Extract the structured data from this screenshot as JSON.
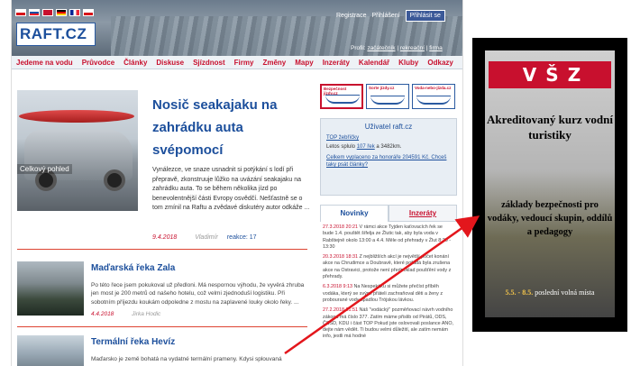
{
  "header": {
    "logo": "RAFT.CZ",
    "flags": [
      "#1c4f9c",
      "#ffffff",
      "#c8102e",
      "#000000",
      "#ce1126",
      "#ffcc00"
    ],
    "links": [
      "Registrace",
      "Přihlášení"
    ],
    "facebook": "Přihlásit se",
    "profil_label": "Profil:",
    "profil_links": [
      "začátečník",
      "rekreační",
      "firma"
    ]
  },
  "nav": [
    "Jedeme na vodu",
    "Průvodce",
    "Články",
    "Diskuse",
    "Sjízdnost",
    "Firmy",
    "Změny",
    "Mapy",
    "Inzeráty",
    "Kalendář",
    "Kluby",
    "Odkazy"
  ],
  "featured": {
    "title": "Nosič seakajaku na zahrádku auta svépomocí",
    "caption": "Celkový pohled",
    "text": "Vynálezce, ve snaze usnadnit si potýkání s lodí při přepravě, zkonstruuje lůžko na uvázání seakajaku na zahrádku auta. To se během několika jízd po benevolentnější části Evropy osvědčí. Nešťastně se o tom zmínil na Raftu a zvědavé diskutéry autor odkáže ...",
    "date": "9.4.2018",
    "author": "Vladimír",
    "reakce": "reakce: 17"
  },
  "articles": [
    {
      "title": "Maďarská řeka Zala",
      "text": "Po této řece jsem pokukoval už předloni. Má nespornou výhodu, že vyvěrá zhruba jen most je 200 metrů od našeho hotelu, což velmi zjednoduší logistiku. Při sobotním příjezdu koukám odpoledne z mostu na zaplavené louky okolo řeky. ...",
      "date": "4.4.2018",
      "author": "Jirka Hodic"
    },
    {
      "title": "Termální řeka Hevíz",
      "text": "Maďarsko je země bohatá na vydatné termální prameny. Kdysi splouvaná"
    }
  ],
  "sidebar": {
    "icons": [
      "Bezpečnost jízdy.cz",
      "Sorte jízdy.cz",
      "Voda-nebo-jízda.cz"
    ],
    "user_title": "Uživatel raft.cz",
    "top_link": "TOP žebříčky",
    "letos_pre": "Letos splulo",
    "letos_link": "107 řek",
    "letos_post": "a 3482km.",
    "celkem_link": "Celkem vyplaceno za honoráře 204591 Kč. Chceš taky psát články?",
    "tab_active": "Novinky",
    "tab_inactive": "Inzeráty",
    "news": [
      {
        "date": "27.3.2018 20:21",
        "text": "V rámci akce Tyjden kaťovacích řek se bude 1.4. pouštět šífelja ze Žlutic tak, aby byla voda v Rabštejně okolo 13:00 a 4.4. Měle od přehrady v Žlut 8:30 - 13:30"
      },
      {
        "date": "20.3.2018 18:31",
        "text": "Z nejbližších akcí je největší počet konání akce na Chrudimce a Doubravě, které pořádá byla zrušena akce na Ostravici, protože není předpoklad poušťění vody z přehrady."
      },
      {
        "date": "6.3.2018 9:13",
        "text": "Na Nespekáku si můžete přečíst příběh vodáka, který se svými přáteli zachraňoval děti a ženy z probourané vody spadlou Trójskou lávkou."
      },
      {
        "date": "27.2.2018 21:51",
        "text": "Náš \"vodácký\" pozměňovací návrh vodního zákona má číslo 377. Zatím máme přislib od Pirátů, ODS, ČSSD, KDU i část TOP Pokud jste oslovovali poslance ANO, dejte nám vědět. Ti budou velmi důležití, ale zatím nemám info, jestli má hodné"
      }
    ]
  },
  "ad": {
    "logo": [
      "V",
      "Š",
      "Z"
    ],
    "headline": "Akreditovaný kurz vodní turistiky",
    "sub": "základy bezpečnosti pro vodáky, vedoucí skupin, oddílů a pedagogy",
    "date_hl": "5.5. - 8.5.",
    "date_rest": "poslední volná místa"
  }
}
